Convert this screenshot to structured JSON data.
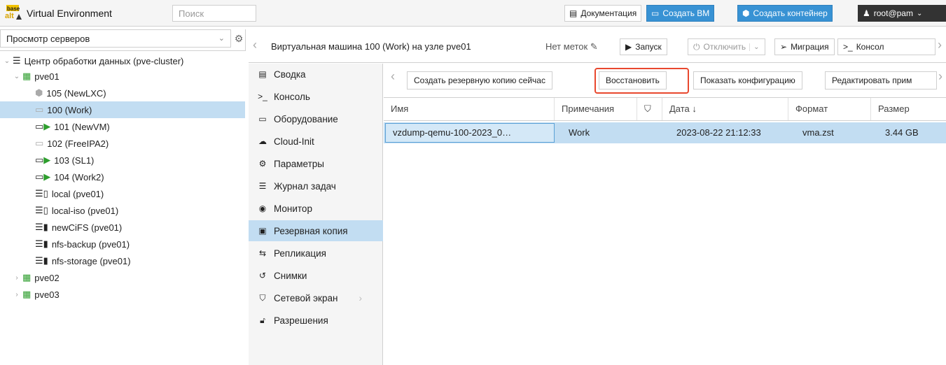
{
  "topbar": {
    "logo_text": "base alt",
    "app_title": "Virtual Environment",
    "search_placeholder": "Поиск",
    "docs_label": "Документация",
    "create_vm_label": "Создать ВМ",
    "create_ct_label": "Создать контейнер",
    "user_label": "root@pam"
  },
  "left": {
    "view_select": "Просмотр серверов",
    "tree": {
      "datacenter": "Центр обработки данных (pve-cluster)",
      "node1": "pve01",
      "items": [
        "105 (NewLXC)",
        "100 (Work)",
        "101 (NewVM)",
        "102 (FreeIPA2)",
        "103 (SL1)",
        "104 (Work2)",
        "local (pve01)",
        "local-iso (pve01)",
        "newCiFS (pve01)",
        "nfs-backup (pve01)",
        "nfs-storage (pve01)"
      ],
      "node2": "pve02",
      "node3": "pve03"
    }
  },
  "header": {
    "title": "Виртуальная машина 100 (Work) на узле pve01",
    "tags": "Нет меток",
    "start": "Запуск",
    "shutdown": "Отключить",
    "migrate": "Миграция",
    "console": "Консол"
  },
  "menu": [
    "Сводка",
    "Консоль",
    "Оборудование",
    "Cloud-Init",
    "Параметры",
    "Журнал задач",
    "Монитор",
    "Резервная копия",
    "Репликация",
    "Снимки",
    "Сетевой экран",
    "Разрешения"
  ],
  "toolbar": {
    "backup_now": "Создать резервную копию сейчас",
    "restore": "Восстановить",
    "show_config": "Показать конфигурацию",
    "edit_notes": "Редактировать прим"
  },
  "grid": {
    "headers": {
      "name": "Имя",
      "notes": "Примечания",
      "date": "Дата ↓",
      "format": "Формат",
      "size": "Размер"
    },
    "rows": [
      {
        "name": "vzdump-qemu-100-2023_0…",
        "notes": "Work",
        "date": "2023-08-22 21:12:33",
        "format": "vma.zst",
        "size": "3.44 GB"
      }
    ]
  },
  "colors": {
    "accent": "#3892d4",
    "selection": "#c2ddf2",
    "highlight": "#e8482e"
  }
}
